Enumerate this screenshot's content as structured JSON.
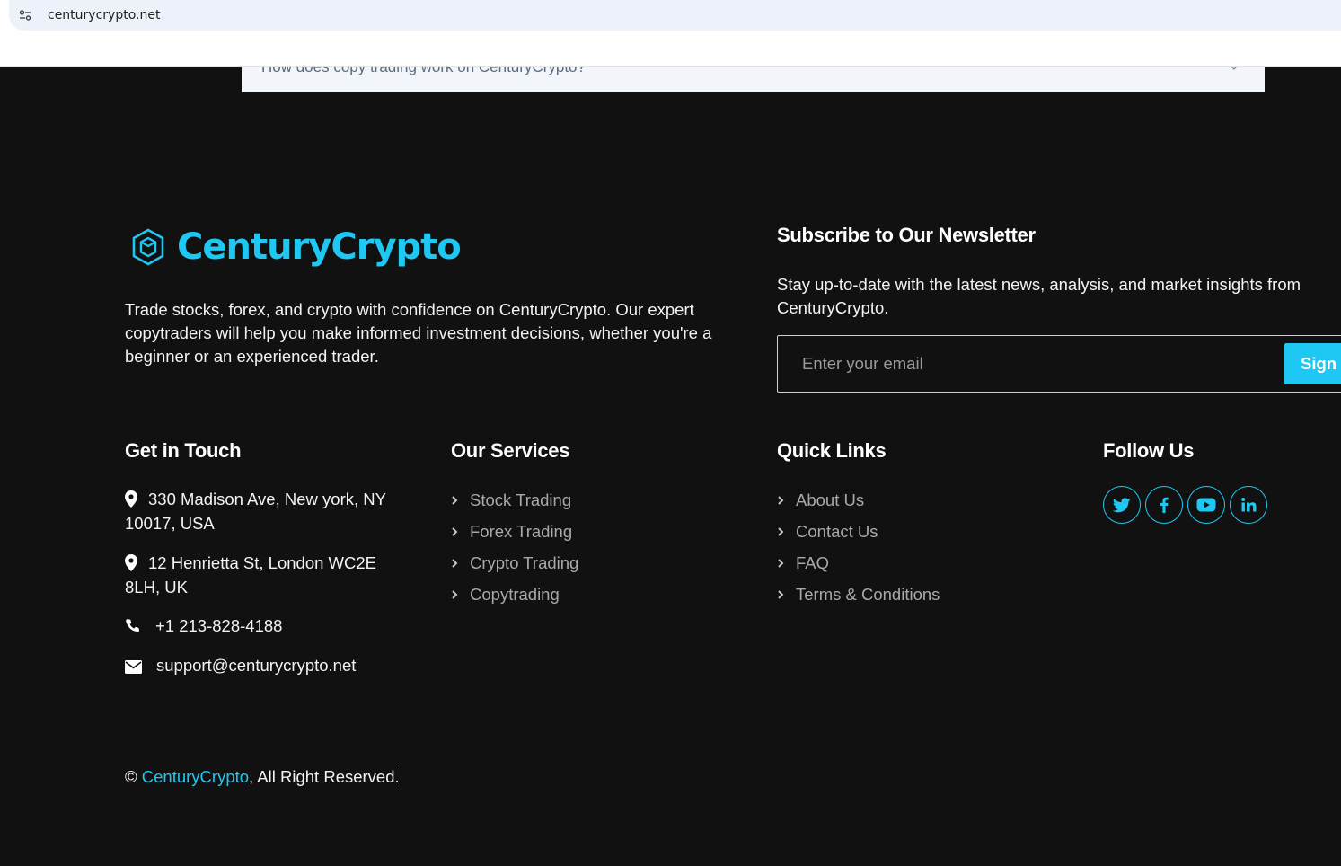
{
  "browser": {
    "url": "centurycrypto.net"
  },
  "faq": {
    "question": "How does copy trading work on CenturyCrypto?"
  },
  "brand": {
    "name": "CenturyCrypto",
    "icon": "hexagon-cube-icon"
  },
  "about": {
    "text": "Trade stocks, forex, and crypto with confidence on CenturyCrypto. Our expert copytraders will help you make informed investment decisions, whether you're a beginner or an experienced trader."
  },
  "newsletter": {
    "title": "Subscribe to Our Newsletter",
    "description": "Stay up-to-date with the latest news, analysis, and market insights from CenturyCrypto.",
    "email_placeholder": "Enter your email",
    "button_label": "Sign Up"
  },
  "contact": {
    "title": "Get in Touch",
    "address_1": "330 Madison Ave, New york, NY 10017, USA",
    "address_2": "12 Henrietta St, London WC2E 8LH, UK",
    "phone": "+1 213-828-4188",
    "email": "support@centurycrypto.net"
  },
  "services": {
    "title": "Our Services",
    "items": [
      "Stock Trading",
      "Forex Trading",
      "Crypto Trading",
      "Copytrading"
    ]
  },
  "quick_links": {
    "title": "Quick Links",
    "items": [
      "About Us",
      "Contact Us",
      "FAQ",
      "Terms & Conditions"
    ]
  },
  "follow": {
    "title": "Follow Us",
    "networks": [
      "twitter-icon",
      "facebook-icon",
      "youtube-icon",
      "linkedin-icon"
    ]
  },
  "footer": {
    "symbol": "© ",
    "brand": "CenturyCrypto",
    "rights": ", All Right Reserved."
  },
  "colors": {
    "accent": "#1ec8f2",
    "background": "#111112"
  }
}
